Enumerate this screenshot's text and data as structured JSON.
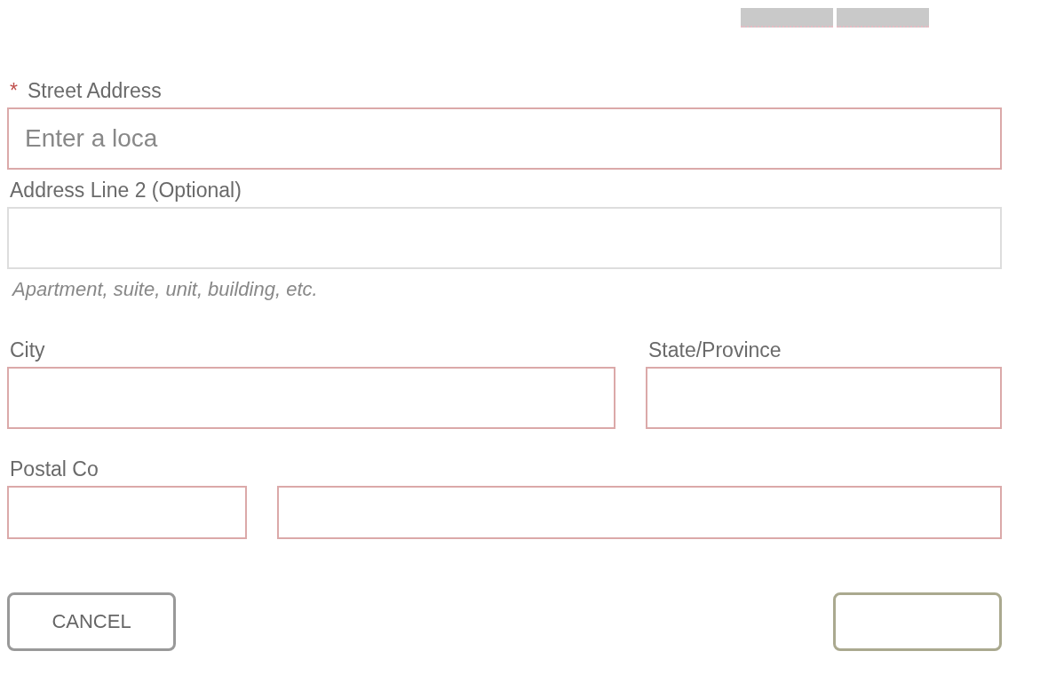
{
  "fields": [
    {
      "label": "Street Address",
      "required_mark": "*",
      "placeholder": "Enter a loca",
      "highlight": true
    },
    {
      "label": "Address Line 2 (Optional)",
      "highlight": false,
      "hint": "Apartment, suite, unit, building, etc."
    }
  ],
  "row_1": [
    {
      "label": "City",
      "highlight": true
    },
    {
      "label": "State/Province",
      "highlight": true
    }
  ],
  "row_2": [
    {
      "label": "Postal Co",
      "highlight": true
    },
    {
      "highlight": true
    }
  ],
  "buttons": [
    {
      "label": "CANCEL",
      "kind": "secondary"
    },
    {
      "kind": "primary"
    }
  ]
}
